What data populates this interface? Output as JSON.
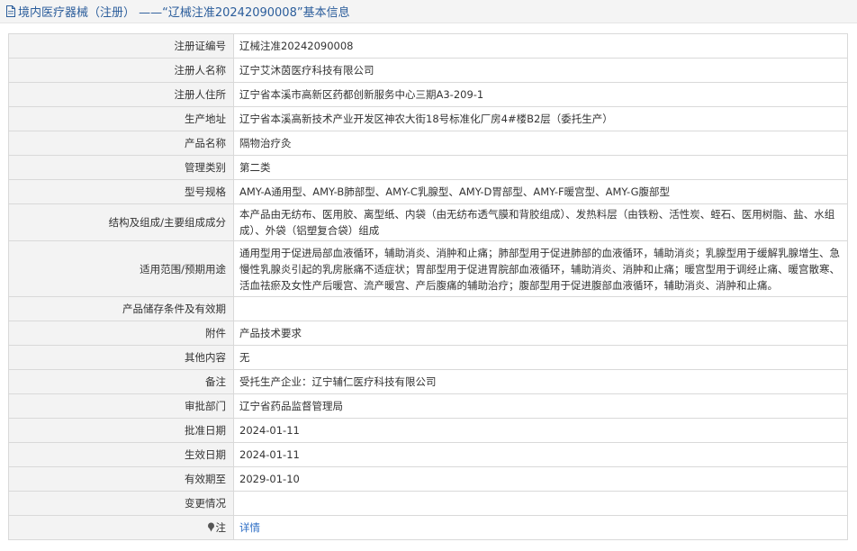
{
  "header": {
    "title": "境内医疗器械（注册） ——“辽械注准20242090008”基本信息",
    "icon": "document-icon"
  },
  "rows": [
    {
      "label": "注册证编号",
      "value": "辽械注准20242090008"
    },
    {
      "label": "注册人名称",
      "value": "辽宁艾沐茵医疗科技有限公司"
    },
    {
      "label": "注册人住所",
      "value": "辽宁省本溪市高新区药都创新服务中心三期A3-209-1"
    },
    {
      "label": "生产地址",
      "value": "辽宁省本溪高新技术产业开发区神农大街18号标准化厂房4#楼B2层（委托生产）"
    },
    {
      "label": "产品名称",
      "value": "隔物治疗灸"
    },
    {
      "label": "管理类别",
      "value": "第二类"
    },
    {
      "label": "型号规格",
      "value": "AMY-A通用型、AMY-B肺部型、AMY-C乳腺型、AMY-D胃部型、AMY-F暖宫型、AMY-G腹部型"
    },
    {
      "label": "结构及组成/主要组成成分",
      "value": "本产品由无纺布、医用胶、离型纸、内袋（由无纺布透气膜和背胶组成）、发热料层（由铁粉、活性炭、蛭石、医用树脂、盐、水组成）、外袋（铝塑复合袋）组成"
    },
    {
      "label": "适用范围/预期用途",
      "value": "通用型用于促进局部血液循环，辅助消炎、消肿和止痛；肺部型用于促进肺部的血液循环，辅助消炎；乳腺型用于缓解乳腺增生、急慢性乳腺炎引起的乳房胀痛不适症状；胃部型用于促进胃脘部血液循环，辅助消炎、消肿和止痛；暖宫型用于调经止痛、暖宫散寒、活血祛瘀及女性产后暖宫、流产暖宫、产后腹痛的辅助治疗；腹部型用于促进腹部血液循环，辅助消炎、消肿和止痛。"
    },
    {
      "label": "产品储存条件及有效期",
      "value": ""
    },
    {
      "label": "附件",
      "value": "产品技术要求"
    },
    {
      "label": "其他内容",
      "value": "无"
    },
    {
      "label": "备注",
      "value": "受托生产企业：辽宁辅仁医疗科技有限公司"
    },
    {
      "label": "审批部门",
      "value": "辽宁省药品监督管理局"
    },
    {
      "label": "批准日期",
      "value": "2024-01-11"
    },
    {
      "label": "生效日期",
      "value": "2024-01-11"
    },
    {
      "label": "有效期至",
      "value": "2029-01-10"
    },
    {
      "label": "变更情况",
      "value": ""
    }
  ],
  "note_row": {
    "label": "注",
    "link": "详情",
    "icon": "pin-icon"
  },
  "colors": {
    "link": "#2b6cc4",
    "title": "#2b5d9b",
    "label_bg": "#f3f3f3",
    "border": "#d9d9d9"
  }
}
